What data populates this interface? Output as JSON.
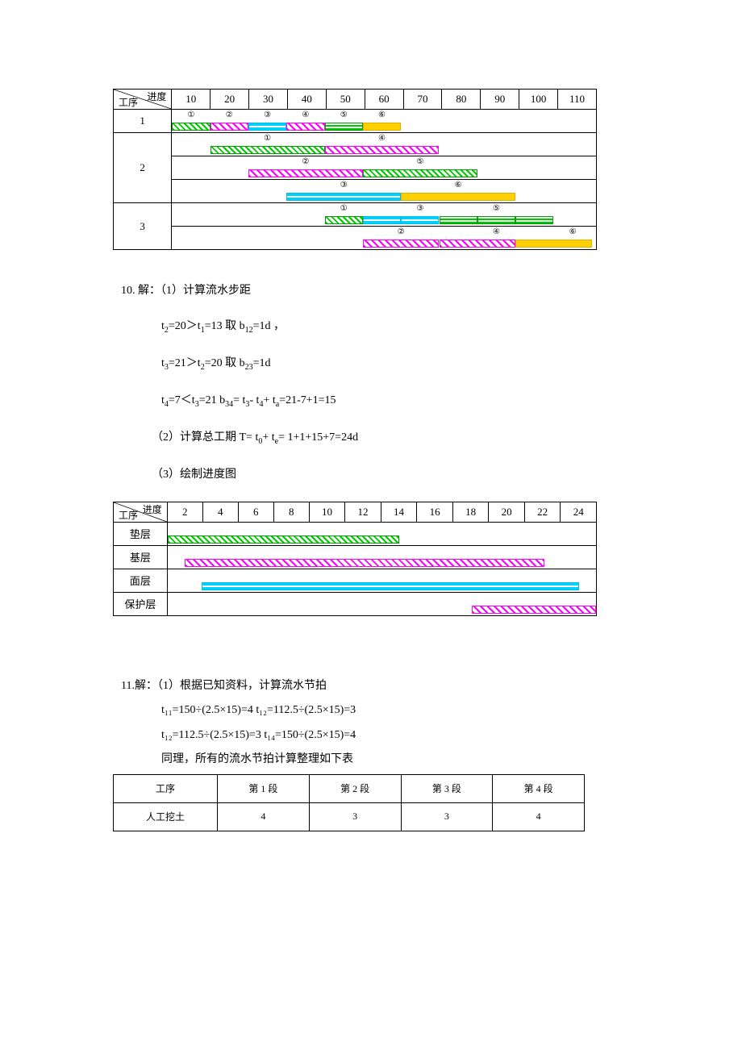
{
  "gantt1": {
    "header_top": "进度",
    "header_bot": "工序",
    "cols": [
      "10",
      "20",
      "30",
      "40",
      "50",
      "60",
      "70",
      "80",
      "90",
      "100",
      "110"
    ],
    "rows": [
      "1",
      "2",
      "3"
    ],
    "circ": [
      "①",
      "②",
      "③",
      "④",
      "⑤",
      "⑥"
    ]
  },
  "sec10": {
    "title": "10. 解：（1）计算流水步距",
    "l1_a": "t",
    "l1_b": "=20＞t",
    "l1_c": "=13    取 b",
    "l1_d": "=1d ，",
    "l2_a": "t",
    "l2_b": "=21＞t",
    "l2_c": "=20    取 b",
    "l2_d": "=1d",
    "l3_a": "t",
    "l3_b": "=7＜t",
    "l3_c": "=21    b",
    "l3_d": "=  t",
    "l3_e": "-  t",
    "l3_f": "+  t",
    "l3_g": "=21-7+1=15",
    "l4": "（2）计算总工期 T=  t",
    "l4_b": "+  t",
    "l4_c": "=  1+1+15+7=24d",
    "l5": "（3）绘制进度图"
  },
  "gantt2": {
    "header_top": "进度",
    "header_bot": "工序",
    "cols": [
      "2",
      "4",
      "6",
      "8",
      "10",
      "12",
      "14",
      "16",
      "18",
      "20",
      "22",
      "24"
    ],
    "rows": [
      "垫层",
      "基层",
      "面层",
      "保护层"
    ]
  },
  "sec11": {
    "title": "11.解：（1）根据已知资料，计算流水节拍",
    "l1": "t₁₁=150÷(2.5×15)=4    t₁₂=112.5÷(2.5×15)=3",
    "l2": "t₁₂=112.5÷(2.5×15)=3    t₁₄=150÷(2.5×15)=4",
    "l3": "同理，所有的流水节拍计算整理如下表"
  },
  "btable": {
    "head": [
      "工序",
      "第 1 段",
      "第 2 段",
      "第 3 段",
      "第 4 段"
    ],
    "r1": [
      "人工挖土",
      "4",
      "3",
      "3",
      "4"
    ]
  }
}
